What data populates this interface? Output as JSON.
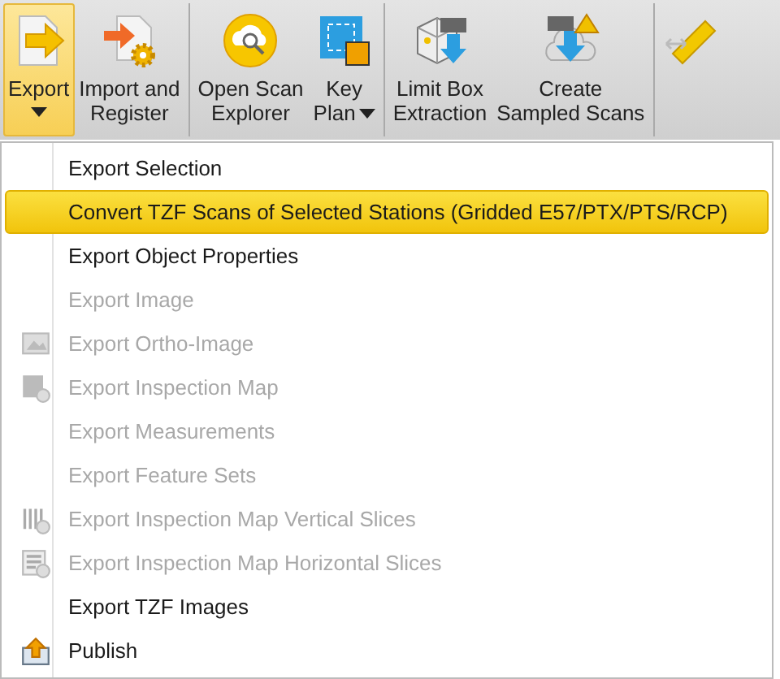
{
  "ribbon": {
    "groups": [
      {
        "buttons": [
          {
            "kind": "export",
            "lines": [
              "Export"
            ],
            "dropdown": true,
            "selected": true
          },
          {
            "kind": "import",
            "lines": [
              "Import and",
              "Register"
            ],
            "dropdown": false,
            "selected": false
          }
        ]
      },
      {
        "buttons": [
          {
            "kind": "scan-explorer",
            "lines": [
              "Open Scan",
              "Explorer"
            ],
            "dropdown": false,
            "selected": false
          },
          {
            "kind": "key-plan",
            "lines": [
              "Key",
              "Plan"
            ],
            "dropdown": true,
            "selected": false
          }
        ]
      },
      {
        "buttons": [
          {
            "kind": "limit-box",
            "lines": [
              "Limit Box",
              "Extraction"
            ],
            "dropdown": false,
            "selected": false
          },
          {
            "kind": "sampled-scans",
            "lines": [
              "Create",
              "Sampled Scans"
            ],
            "dropdown": false,
            "selected": false
          }
        ]
      },
      {
        "buttons": [
          {
            "kind": "ruler",
            "dropdown": false,
            "selected": false
          }
        ]
      }
    ]
  },
  "menu": {
    "items": [
      {
        "label": "Export Selection",
        "kind": "plain",
        "selected": false,
        "disabled": false
      },
      {
        "label": "Convert TZF Scans of Selected Stations (Gridded E57/PTX/PTS/RCP)",
        "kind": "plain",
        "selected": true,
        "disabled": false
      },
      {
        "label": "Export Object Properties",
        "kind": "plain",
        "selected": false,
        "disabled": false
      },
      {
        "label": "Export Image",
        "kind": "plain",
        "selected": false,
        "disabled": true
      },
      {
        "label": "Export Ortho-Image",
        "kind": "image",
        "selected": false,
        "disabled": true
      },
      {
        "label": "Export Inspection Map",
        "kind": "map",
        "selected": false,
        "disabled": true
      },
      {
        "label": "Export Measurements",
        "kind": "plain",
        "selected": false,
        "disabled": true
      },
      {
        "label": "Export Feature Sets",
        "kind": "plain",
        "selected": false,
        "disabled": true
      },
      {
        "label": "Export Inspection Map Vertical Slices",
        "kind": "vertical",
        "selected": false,
        "disabled": true
      },
      {
        "label": "Export Inspection Map Horizontal Slices",
        "kind": "horizontal",
        "selected": false,
        "disabled": true
      },
      {
        "label": "Export TZF Images",
        "kind": "plain",
        "selected": false,
        "disabled": false
      },
      {
        "label": "Publish",
        "kind": "publish",
        "selected": false,
        "disabled": false
      }
    ]
  }
}
